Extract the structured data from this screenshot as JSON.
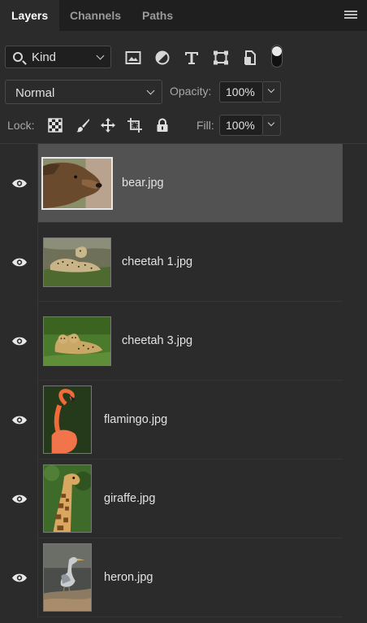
{
  "tabs": [
    {
      "label": "Layers",
      "active": true
    },
    {
      "label": "Channels",
      "active": false
    },
    {
      "label": "Paths",
      "active": false
    }
  ],
  "filter": {
    "kind_label": "Kind",
    "icons": [
      "image-filter-icon",
      "adjustment-filter-icon",
      "type-filter-icon",
      "shape-filter-icon",
      "smart-object-filter-icon"
    ],
    "filter_toggle": "on"
  },
  "blend": {
    "mode": "Normal",
    "opacity_label": "Opacity:",
    "opacity_value": "100%"
  },
  "lock": {
    "label": "Lock:",
    "icons": [
      "lock-transparent-pixels-icon",
      "lock-image-pixels-icon",
      "lock-position-icon",
      "lock-artboard-icon",
      "lock-all-icon"
    ],
    "fill_label": "Fill:",
    "fill_value": "100%"
  },
  "layers": [
    {
      "name": "bear.jpg",
      "selected": true,
      "visible": true
    },
    {
      "name": "cheetah 1.jpg",
      "selected": false,
      "visible": true
    },
    {
      "name": "cheetah 3.jpg",
      "selected": false,
      "visible": true
    },
    {
      "name": "flamingo.jpg",
      "selected": false,
      "visible": true
    },
    {
      "name": "giraffe.jpg",
      "selected": false,
      "visible": true
    },
    {
      "name": "heron.jpg",
      "selected": false,
      "visible": true
    }
  ],
  "colors": {
    "panel_bg": "#2b2b2b",
    "tabbar_bg": "#1f1f1f",
    "selected_layer_bg": "#525252"
  }
}
